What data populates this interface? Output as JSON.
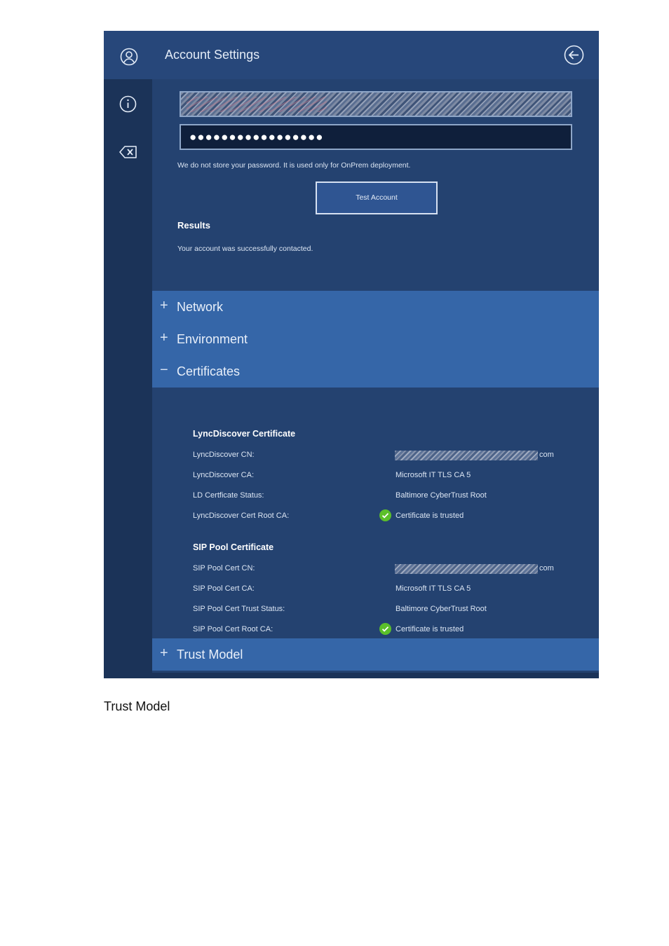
{
  "app": {
    "title": "Account Settings",
    "rail_icons": [
      "person-icon",
      "info-icon",
      "backspace-icon"
    ],
    "back_icon": "back-arrow-icon"
  },
  "form": {
    "password_value": "●●●●●●●●●●●●●●●●●",
    "note": "We do not store your password. It is used only for OnPrem deployment.",
    "test_button": "Test Account",
    "results_heading": "Results",
    "results_text": "Your account was successfully contacted."
  },
  "sections": {
    "network": {
      "label": "Network",
      "state": "+"
    },
    "environment": {
      "label": "Environment",
      "state": "+"
    },
    "certificates": {
      "label": "Certificates",
      "state": "−"
    },
    "trust_model": {
      "label": "Trust Model",
      "state": "+"
    }
  },
  "lync_cert": {
    "heading": "LyncDiscover Certificate",
    "rows": [
      {
        "key": "LyncDiscover CN:",
        "value": "com"
      },
      {
        "key": "LyncDiscover CA:",
        "value": "Microsoft IT TLS CA 5"
      },
      {
        "key": "LD Certficate Status:",
        "value": "Baltimore CyberTrust Root"
      },
      {
        "key": "LyncDiscover Cert Root CA:",
        "value": "Certificate is trusted"
      }
    ]
  },
  "sip_cert": {
    "heading": "SIP Pool Certificate",
    "rows": [
      {
        "key": "SIP Pool Cert CN:",
        "value": "com"
      },
      {
        "key": "SIP Pool Cert CA:",
        "value": "Microsoft IT TLS CA 5"
      },
      {
        "key": "SIP Pool Cert Trust Status:",
        "value": "Baltimore CyberTrust Root"
      },
      {
        "key": "SIP Pool Cert Root CA:",
        "value": "Certificate is trusted"
      }
    ]
  },
  "caption": "Trust Model",
  "colors": {
    "rail": "#1b3358",
    "header": "#27477a",
    "section_bar": "#3566a8",
    "trusted_check": "#5bbf2a"
  }
}
